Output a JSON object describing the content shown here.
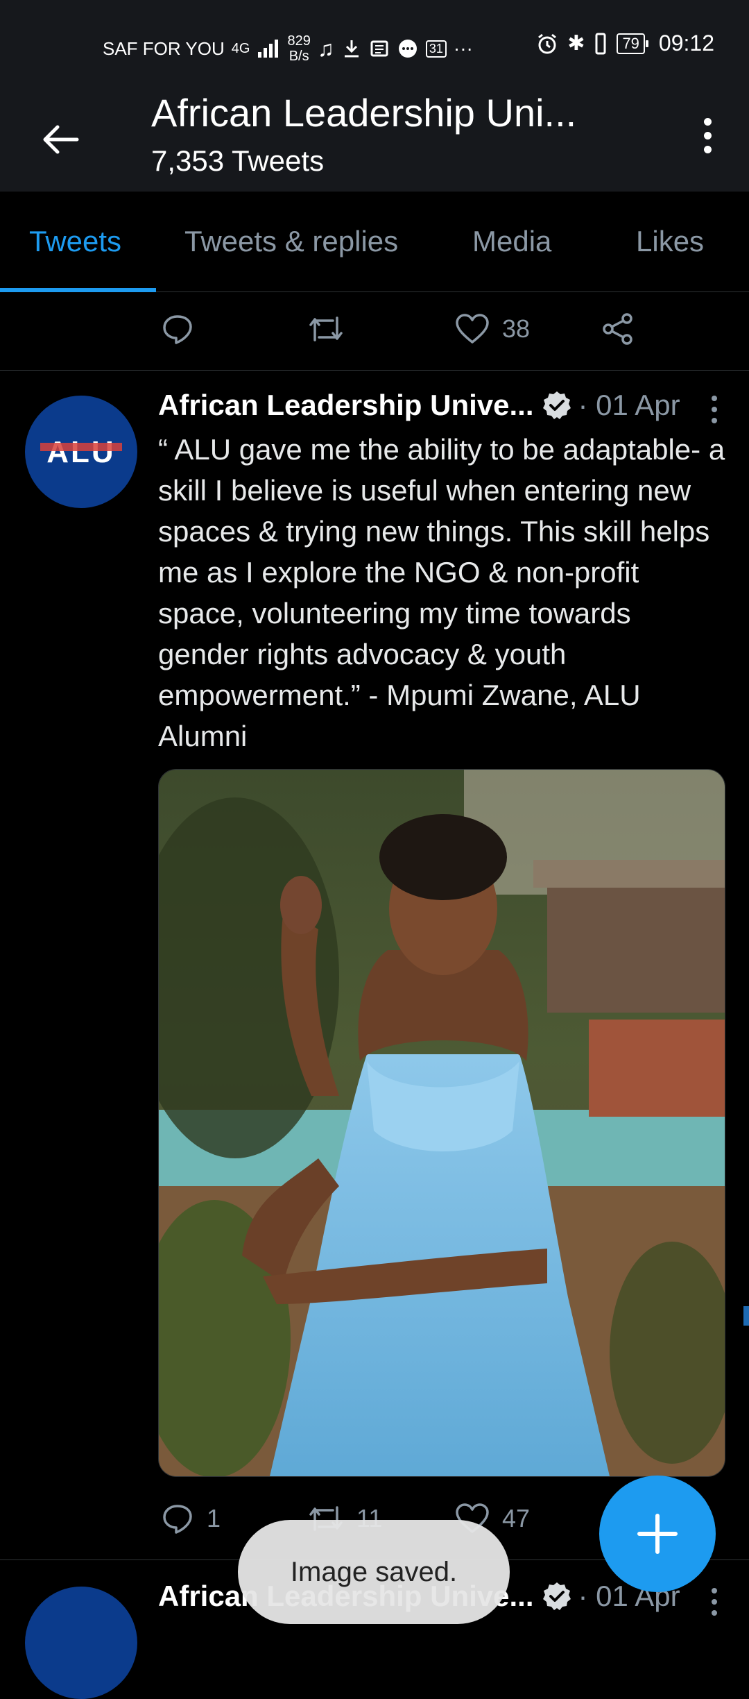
{
  "status_bar": {
    "carrier": "SAF FOR YOU",
    "network": "4G",
    "speed_value": "829",
    "speed_unit": "B/s",
    "calendar_day": "31",
    "more_glyph": "···",
    "battery_level": "79",
    "time": "09:12"
  },
  "header": {
    "title": "African Leadership Uni...",
    "tweet_count": "7,353 Tweets"
  },
  "tabs": [
    "Tweets",
    "Tweets & replies",
    "Media",
    "Likes"
  ],
  "active_tab": "Tweets",
  "previous_tweet_actions": {
    "likes": "38"
  },
  "tweet": {
    "author": "African Leadership Unive...",
    "verified": true,
    "date": "· 01 Apr",
    "avatar_text": "ALU",
    "text": "“ ALU gave me the ability to be adaptable- a skill I believe is useful when entering new spaces & trying new things. This skill helps me as I explore the NGO &  non-profit space, volunteering my time towards gender rights advocacy & youth empowerment.” - Mpumi Zwane, ALU Alumni",
    "replies": "1",
    "retweets": "11",
    "likes": "47"
  },
  "next_tweet": {
    "author": "African Leadership Unive...",
    "date": "· 01 Apr"
  },
  "toast": "Image saved.",
  "colors": {
    "accent": "#1d9bf0",
    "background": "#000000",
    "bar": "#16181c",
    "muted": "#8b98a5",
    "avatar": "#0b3b8c",
    "logo_red": "#d9423b"
  }
}
